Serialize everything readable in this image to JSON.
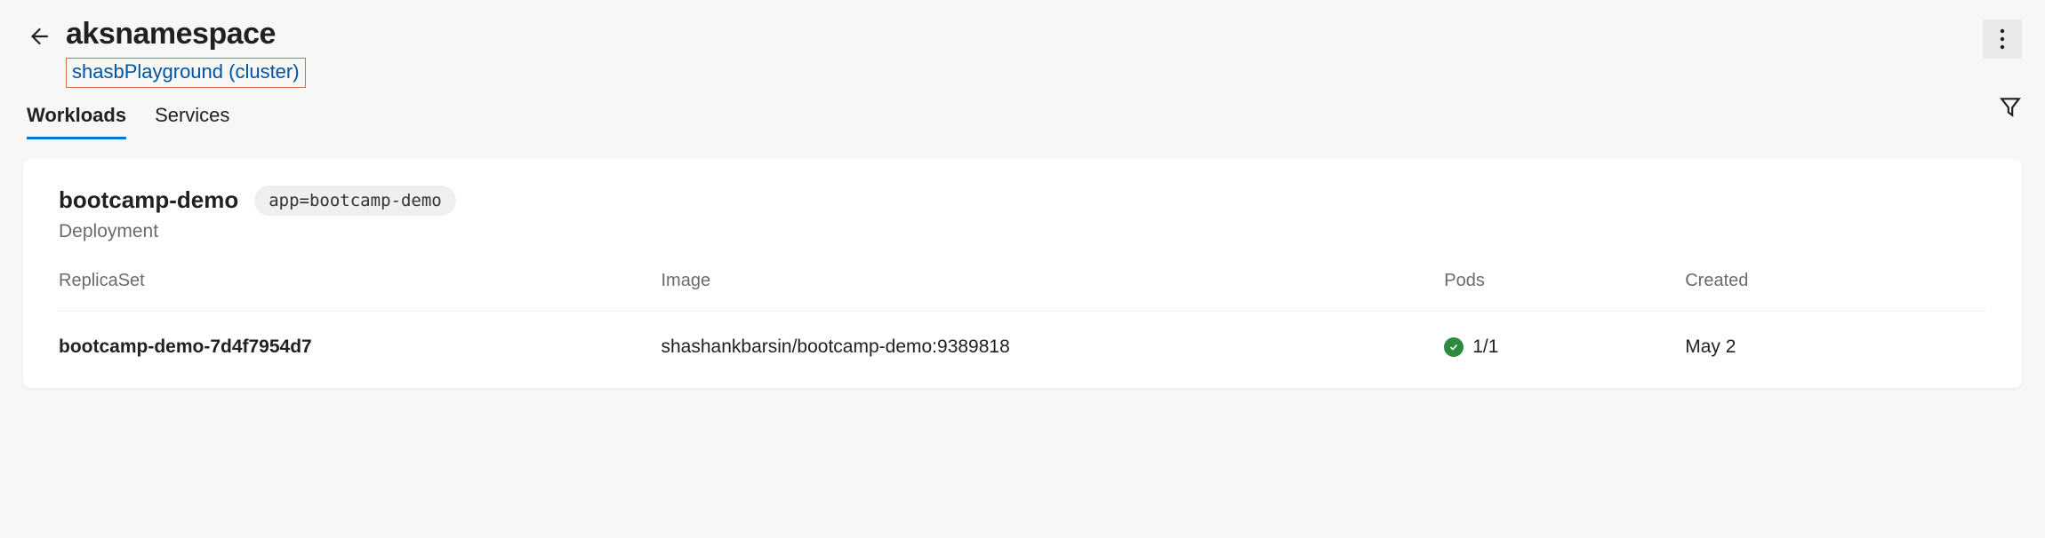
{
  "header": {
    "title": "aksnamespace",
    "cluster_link": "shasbPlayground (cluster)"
  },
  "tabs": {
    "workloads": "Workloads",
    "services": "Services"
  },
  "deployment": {
    "name": "bootcamp-demo",
    "label": "app=bootcamp-demo",
    "type": "Deployment"
  },
  "table": {
    "columns": {
      "replicaset": "ReplicaSet",
      "image": "Image",
      "pods": "Pods",
      "created": "Created"
    },
    "rows": [
      {
        "name": "bootcamp-demo-7d4f7954d7",
        "image": "shashankbarsin/bootcamp-demo:9389818",
        "pods": "1/1",
        "created": "May 2"
      }
    ]
  }
}
